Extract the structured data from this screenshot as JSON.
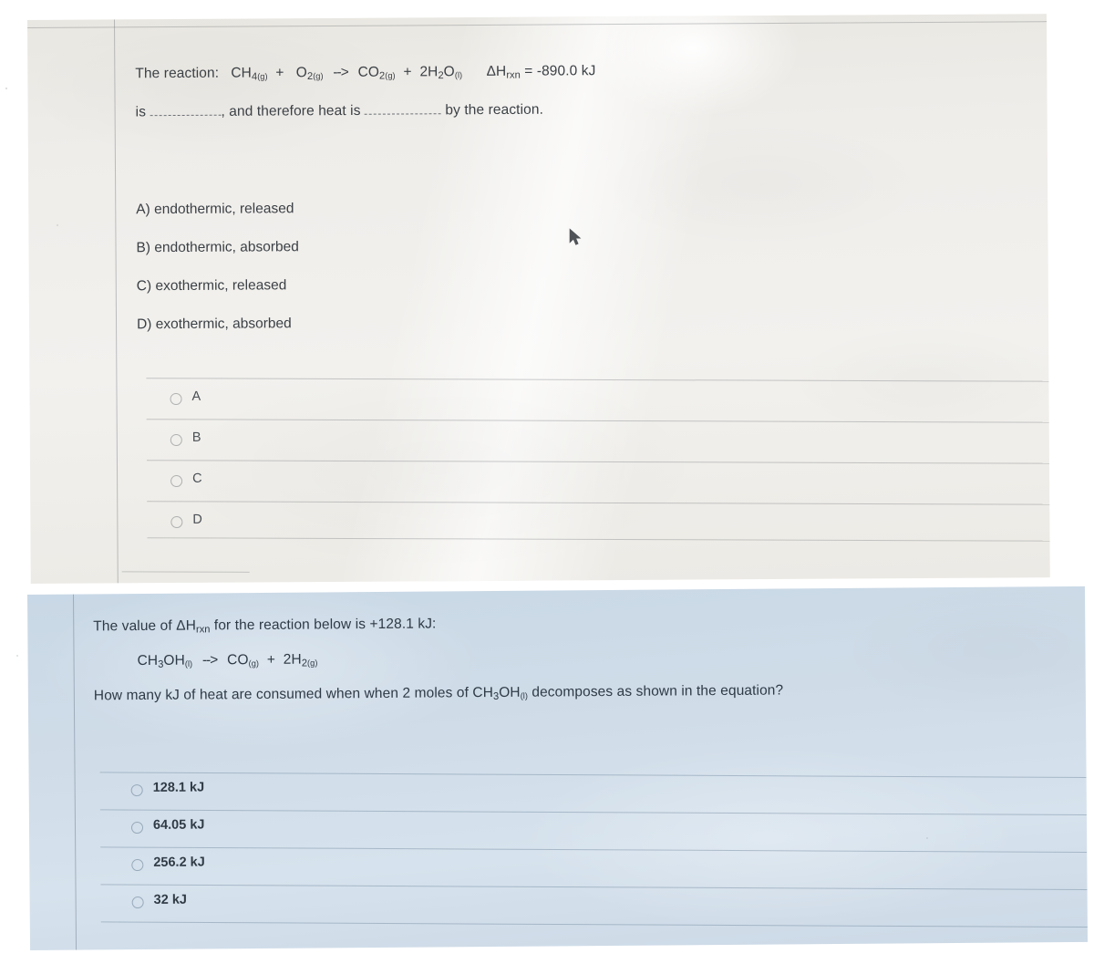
{
  "question_one": {
    "prompt_prefix": "The reaction:",
    "equation": {
      "reactant_1": {
        "formula": "CH",
        "sub": "4",
        "state": "(g)"
      },
      "plus_1": "+",
      "reactant_2": {
        "formula": "O",
        "sub": "2",
        "state": "(g)"
      },
      "arrow": "-->",
      "product_1": {
        "formula": "CO",
        "sub": "2",
        "state": "(g)"
      },
      "plus_2": "+",
      "product_2": {
        "coefficient": "2H",
        "sub": "2",
        "formula": "O",
        "state": "(l)"
      },
      "enthalpy_symbol": "ΔH",
      "enthalpy_subscript": "rxn",
      "enthalpy_equals": "=",
      "enthalpy_value": "-890.0 kJ"
    },
    "blank_line_start": "is",
    "blank_line_middle": ", and therefore heat is",
    "blank_line_end": "by the reaction.",
    "printed_choices": [
      "A) endothermic, released",
      "B) endothermic, absorbed",
      "C) exothermic, released",
      "D) exothermic, absorbed"
    ],
    "options": [
      {
        "label": "A"
      },
      {
        "label": "B"
      },
      {
        "label": "C"
      },
      {
        "label": "D"
      }
    ]
  },
  "question_two": {
    "prompt_prefix": "The value of",
    "enthalpy_symbol": "ΔH",
    "enthalpy_subscript": "rxn",
    "prompt_middle": "for the reaction below is +128.1 kJ:",
    "equation": {
      "reactant": {
        "formula_a": "CH",
        "sub_a": "3",
        "formula_b": "OH",
        "state_a": "(l)"
      },
      "arrow": "-->",
      "product_1": {
        "formula": "CO",
        "state": "(g)"
      },
      "plus": "+",
      "product_2": {
        "coefficient": "2H",
        "sub": "2",
        "state": "(g)"
      }
    },
    "question_part_a": "How many kJ of heat are consumed when when 2 moles of",
    "question_inline_formula": {
      "formula_a": "CH",
      "sub_a": "3",
      "formula_b": "OH",
      "state_a": "(l)"
    },
    "question_part_b": "decomposes as shown in the equation?",
    "options": [
      {
        "label": "128.1 kJ"
      },
      {
        "label": "64.05 kJ"
      },
      {
        "label": "256.2 kJ"
      },
      {
        "label": "32 kJ"
      }
    ]
  },
  "colors": {
    "panel_one_paper": "#efedea",
    "panel_two_paper": "#cfdce8",
    "text": "#3b4045",
    "separator": "#82868a"
  },
  "cursor": {
    "icon": "mouse-pointer-icon"
  }
}
